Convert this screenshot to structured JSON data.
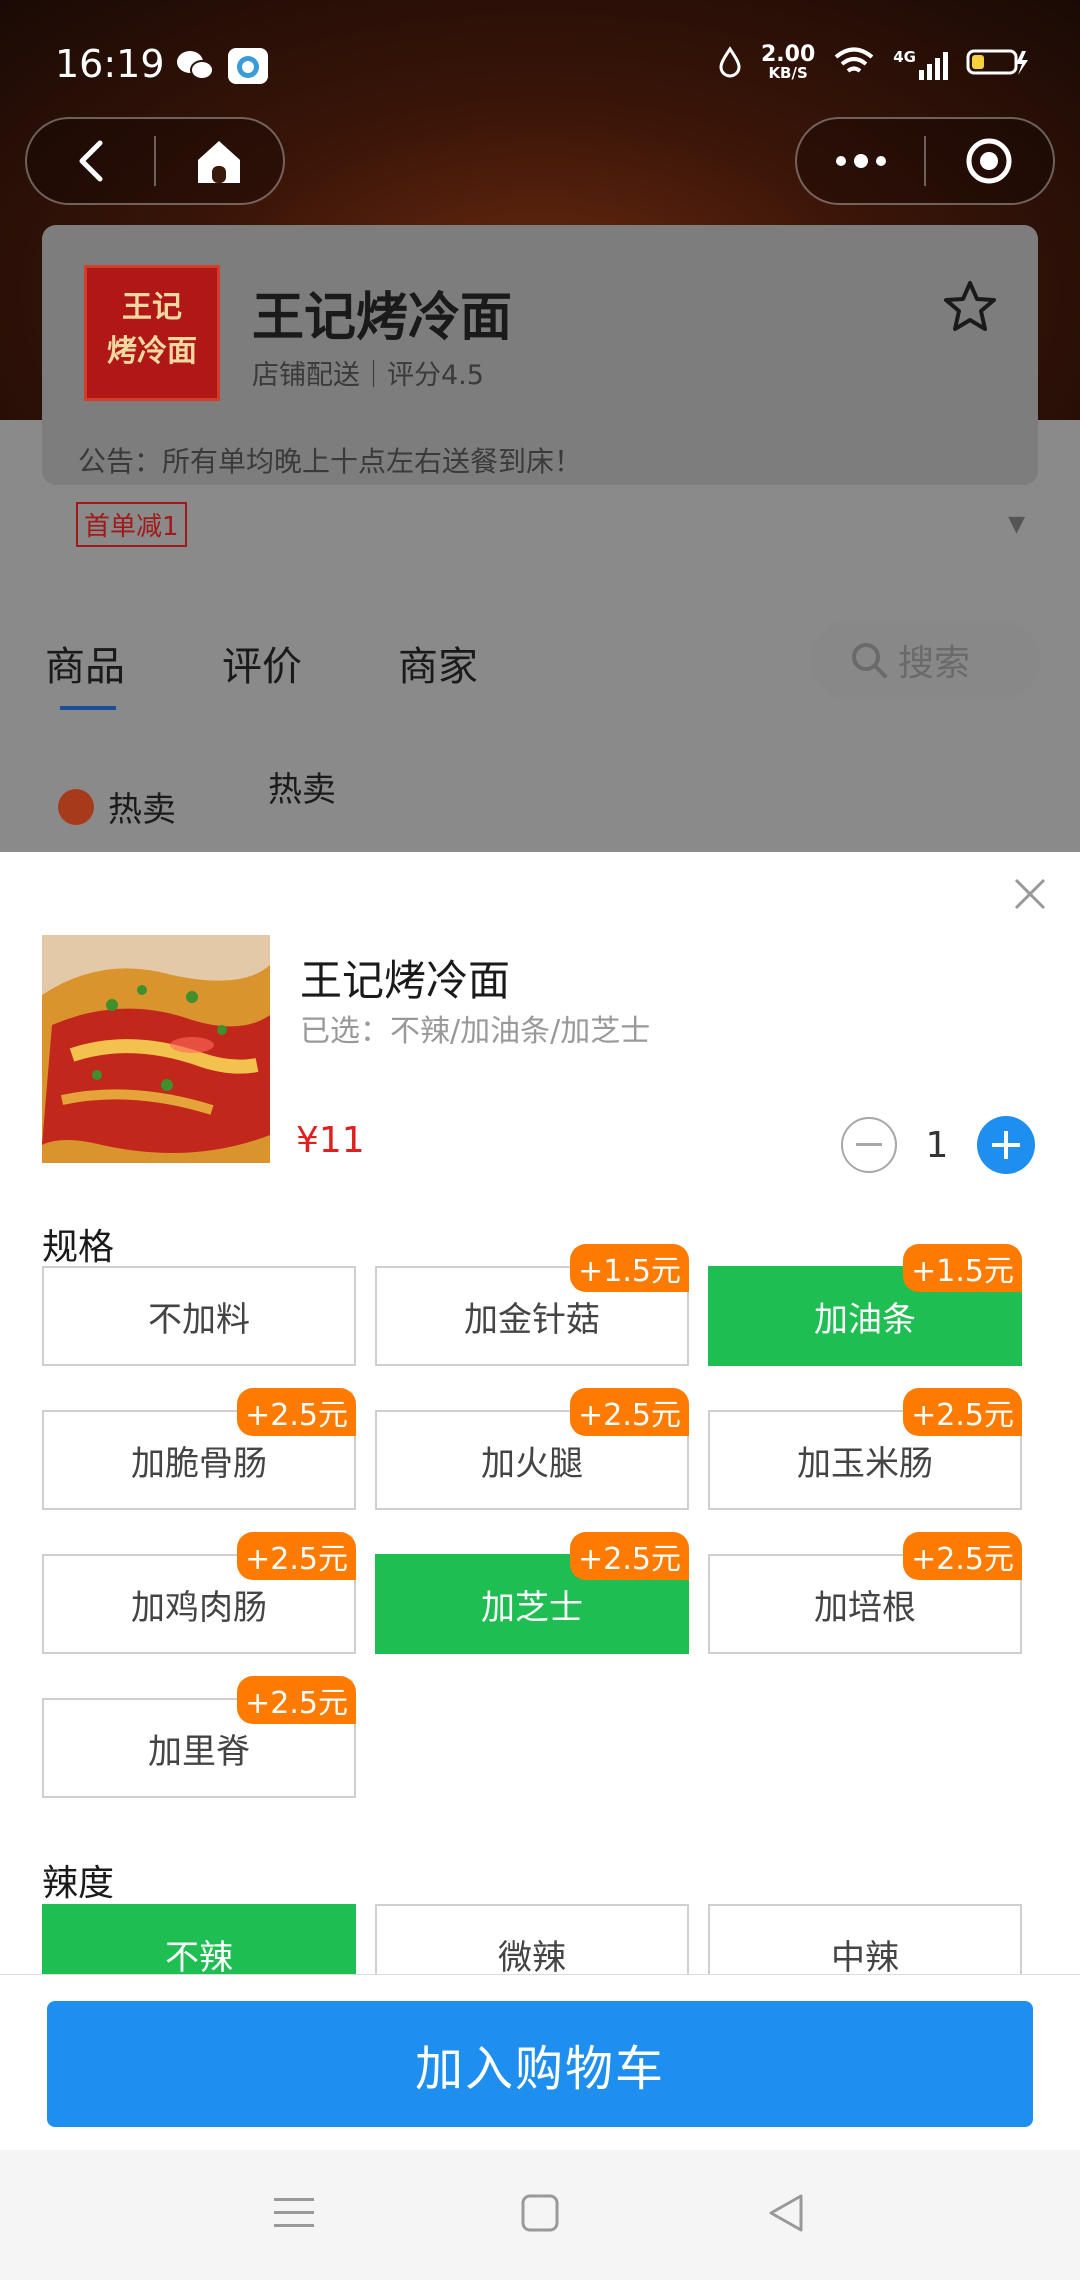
{
  "status": {
    "time": "16:19",
    "net_speed_value": "2.00",
    "net_speed_unit": "KB/S",
    "network": "4G"
  },
  "shop": {
    "name": "王记烤冷面",
    "logo_text_line1": "王记",
    "logo_text_line2": "烤冷面",
    "subtitle": "店铺配送｜评分4.5",
    "notice": "公告：所有单均晚上十点左右送餐到床！",
    "promo": "首单减1"
  },
  "tabs": [
    {
      "label": "商品"
    },
    {
      "label": "评价"
    },
    {
      "label": "商家"
    }
  ],
  "search": {
    "label": "搜索"
  },
  "category": {
    "side_label": "热卖",
    "section_title": "热卖"
  },
  "item": {
    "name": "王记烤冷面",
    "selected": "已选：不辣/加油条/加芝士",
    "price": "¥11",
    "quantity": "1"
  },
  "spec": {
    "title": "规格",
    "options": [
      {
        "label": "不加料",
        "badge": "",
        "selected": false
      },
      {
        "label": "加金针菇",
        "badge": "+1.5元",
        "selected": false
      },
      {
        "label": "加油条",
        "badge": "+1.5元",
        "selected": true
      },
      {
        "label": "加脆骨肠",
        "badge": "+2.5元",
        "selected": false
      },
      {
        "label": "加火腿",
        "badge": "+2.5元",
        "selected": false
      },
      {
        "label": "加玉米肠",
        "badge": "+2.5元",
        "selected": false
      },
      {
        "label": "加鸡肉肠",
        "badge": "+2.5元",
        "selected": false
      },
      {
        "label": "加芝士",
        "badge": "+2.5元",
        "selected": true
      },
      {
        "label": "加培根",
        "badge": "+2.5元",
        "selected": false
      },
      {
        "label": "加里脊",
        "badge": "+2.5元",
        "selected": false
      }
    ]
  },
  "spice": {
    "title": "辣度",
    "options": [
      {
        "label": "不辣",
        "selected": true
      },
      {
        "label": "微辣",
        "selected": false
      },
      {
        "label": "中辣",
        "selected": false
      }
    ]
  },
  "cart_button": "加入购物车",
  "colors": {
    "accent_blue": "#1e8fef",
    "selected_green": "#1ebe52",
    "badge_orange": "#ff7a00",
    "price_red": "#e02020"
  }
}
